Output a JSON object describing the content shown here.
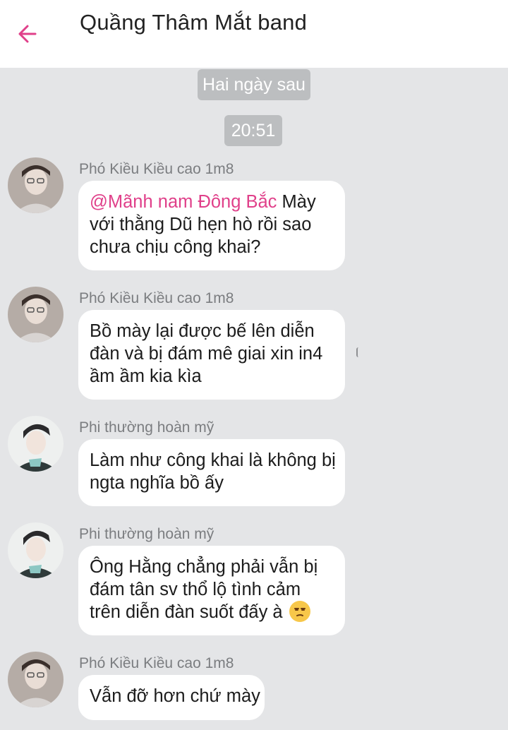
{
  "header": {
    "title": "Quầng Thâm Mắt band",
    "back_icon": "arrow-left-icon",
    "accent_color": "#e0408a"
  },
  "date_separator": "Hai ngày sau",
  "time_separator": "20:51",
  "messages": [
    {
      "sender": "Phó Kiều Kiều cao 1m8",
      "mention": "@Mãnh nam Đông Bắc",
      "lines": [
        "Mày",
        "với thằng Dũ hẹn hò rồi sao",
        "chưa chịu công khai?"
      ]
    },
    {
      "sender": "Phó Kiều Kiều cao 1m8",
      "lines": [
        "Bồ mày lại được bế lên diễn",
        "đàn và bị đám mê giai xin in4",
        "ầm ầm kia kìa"
      ]
    },
    {
      "sender": "Phi thường hoàn mỹ",
      "lines": [
        "Làm như công khai là không bị",
        "ngta nghĩa bồ ấy"
      ]
    },
    {
      "sender": "Phi thường hoàn mỹ",
      "lines": [
        "Ông Hằng chẳng phải vẫn bị",
        "đám tân sv thổ lộ tình cảm",
        "trên diễn đàn suốt đấy à"
      ],
      "emoji": "unamused-face-icon"
    },
    {
      "sender": "Phó Kiều Kiều cao 1m8",
      "lines": [
        "Vẫn đỡ hơn chứ mày"
      ]
    }
  ]
}
